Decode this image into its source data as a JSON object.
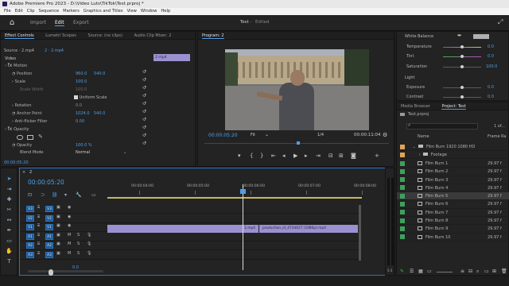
{
  "title": "Adobe Premiere Pro 2023 - D:\\Video Luts\\TikTok\\Test.prproj *",
  "menu": [
    "File",
    "Edit",
    "Clip",
    "Sequence",
    "Markers",
    "Graphics and Titles",
    "View",
    "Window",
    "Help"
  ],
  "workspace": {
    "tabs": [
      "Import",
      "Edit",
      "Export"
    ],
    "active": "Edit",
    "project": "Test",
    "status": "Edited"
  },
  "effect_controls": {
    "tabs": [
      "Effect Controls",
      "Lumetri Scopes",
      "Source: (no clips)",
      "Audio Clip Mixer: 2"
    ],
    "source": "Source · 2.mp4",
    "sequence": "2 · 2.mp4",
    "clip_label": "2.mp4",
    "video_label": "Video",
    "motion": "Motion",
    "position": {
      "label": "Position",
      "x": "960.0",
      "y": "540.0"
    },
    "scale": {
      "label": "Scale",
      "value": "100.0"
    },
    "scale_width": {
      "label": "Scale Width",
      "value": "100.0"
    },
    "uniform": "Uniform Scale",
    "rotation": {
      "label": "Rotation",
      "value": "0.0"
    },
    "anchor": {
      "label": "Anchor Point",
      "x": "1024.0",
      "y": "540.0"
    },
    "antiflicker": {
      "label": "Anti-flicker Filter",
      "value": "0.00"
    },
    "opacity_group": "Opacity",
    "opacity": {
      "label": "Opacity",
      "value": "100.0 %"
    },
    "blend": {
      "label": "Blend Mode",
      "value": "Normal"
    },
    "timecode": "00:00:05:20"
  },
  "program": {
    "title": "Program: 2",
    "timecode": "00:00:05:20",
    "fit": "Fit",
    "fraction": "1/4",
    "duration": "00:00:11:04"
  },
  "lumetri": {
    "wb": "White Balance",
    "temperature": {
      "label": "Temperature",
      "value": "0.0"
    },
    "tint": {
      "label": "Tint",
      "value": "0.0"
    },
    "saturation": {
      "label": "Saturation",
      "value": "100.0"
    },
    "light": "Light",
    "exposure": {
      "label": "Exposure",
      "value": "0.0"
    },
    "contrast": {
      "label": "Contrast",
      "value": "0.0"
    }
  },
  "project": {
    "tabs": [
      "Media Browser",
      "Project: Test"
    ],
    "file": "Test.prproj",
    "count": "1 of...",
    "col_name": "Name",
    "col_rate": "Frame Ra",
    "bin": {
      "name": "Film Burn 1920 1080 HD",
      "rate": ""
    },
    "footage": "Footage",
    "items": [
      {
        "name": "Film Burn 1",
        "rate": "29.97 f"
      },
      {
        "name": "Film Burn 2",
        "rate": "29.97 f"
      },
      {
        "name": "Film Burn 3",
        "rate": "29.97 f"
      },
      {
        "name": "Film Burn 4",
        "rate": "29.97 f"
      },
      {
        "name": "Film Burn 5",
        "rate": "29.97 f"
      },
      {
        "name": "Film Burn 6",
        "rate": "29.97 f"
      },
      {
        "name": "Film Burn 7",
        "rate": "29.97 f"
      },
      {
        "name": "Film Burn 8",
        "rate": "29.97 f"
      },
      {
        "name": "Film Burn 9",
        "rate": "29.97 f"
      },
      {
        "name": "Film Burn 10",
        "rate": "29.97 f"
      }
    ]
  },
  "timeline": {
    "tab": "2",
    "timecode": "00:00:05:20",
    "ruler": [
      "00:00:04:00",
      "00:00:05:00",
      "00:00:06:00",
      "00:00:07:00",
      "00:00:08:00"
    ],
    "tracks": [
      {
        "src": "V3",
        "name": "V3"
      },
      {
        "src": "V2",
        "name": "V2"
      },
      {
        "src": "V1",
        "name": "V1"
      },
      {
        "src": "A1",
        "name": "A1"
      },
      {
        "src": "A2",
        "name": "A2"
      },
      {
        "src": "A3",
        "name": "A3"
      }
    ],
    "clip1": "2.mp4",
    "clip2": "production_id_4734627 (1080p).mp4",
    "mix": "0.0"
  },
  "colors": {
    "accent": "#4e9fe8",
    "clip": "#9b91d1",
    "track_tag": "#1f5a96",
    "swatch": "#3fa05d"
  }
}
